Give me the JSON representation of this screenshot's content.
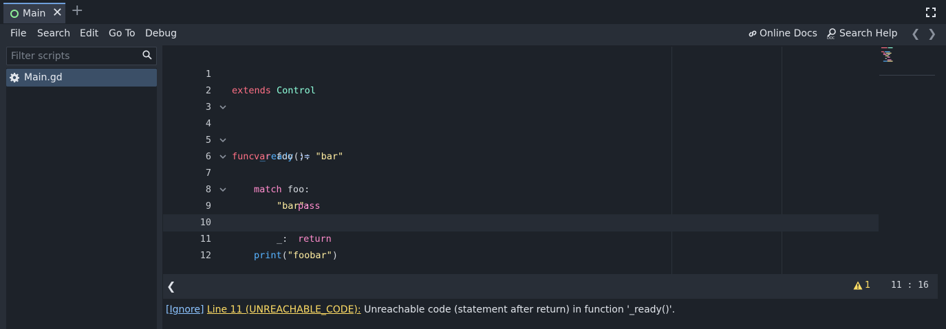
{
  "tabs": {
    "scene_tab_label": "Main",
    "close_glyph": "✕",
    "add_glyph": "+"
  },
  "menu": {
    "items": [
      "File",
      "Search",
      "Edit",
      "Go To",
      "Debug"
    ],
    "online_docs": "Online Docs",
    "search_help": "Search Help",
    "back_glyph": "❮",
    "forward_glyph": "❯"
  },
  "scripts_panel": {
    "filter_placeholder": "Filter scripts",
    "scripts": [
      {
        "name": "Main.gd",
        "selected": true
      }
    ]
  },
  "editor": {
    "current_line": 11,
    "lines": [
      {
        "n": "1"
      },
      {
        "n": "2"
      },
      {
        "n": "3"
      },
      {
        "n": "4"
      },
      {
        "n": "5"
      },
      {
        "n": "6"
      },
      {
        "n": "7"
      },
      {
        "n": "8"
      },
      {
        "n": "9"
      },
      {
        "n": "10"
      },
      {
        "n": "11"
      },
      {
        "n": "12"
      }
    ],
    "tokens": {
      "extends": "extends",
      "control": "Control",
      "func": "func",
      "ready_name": "_ready",
      "ready_parens": "():",
      "var": "var",
      "foo_decl": " foo ",
      "infer_op": ":=",
      "bar_str": "\"bar\"",
      "match": "match",
      "match_subject": " foo:",
      "bar_pattern": "\"bar\"",
      "colon": ":",
      "pass": "pass",
      "wildcard": "_",
      "wildcard_colon": ":",
      "return": "return",
      "print": "print",
      "paren_open": "(",
      "foobar_str": "\"foobar\"",
      "paren_close": ")"
    }
  },
  "status": {
    "collapse_glyph": "❮",
    "warning_count": "1",
    "cursor_line": "11",
    "cursor_sep": " : ",
    "cursor_col": "16"
  },
  "warnings_panel": {
    "ignore_label": "[Ignore]",
    "line_label": "Line 11 (UNREACHABLE_CODE):",
    "message": " Unreachable code (statement after return) in function '_ready()'."
  },
  "colors": {
    "keyword": "#ff7085",
    "control_flow": "#ff8ccc",
    "type": "#8effda",
    "function": "#57b3ff",
    "string": "#ffeda1",
    "warning": "#ffdd65",
    "accent": "#6fa0dc"
  }
}
